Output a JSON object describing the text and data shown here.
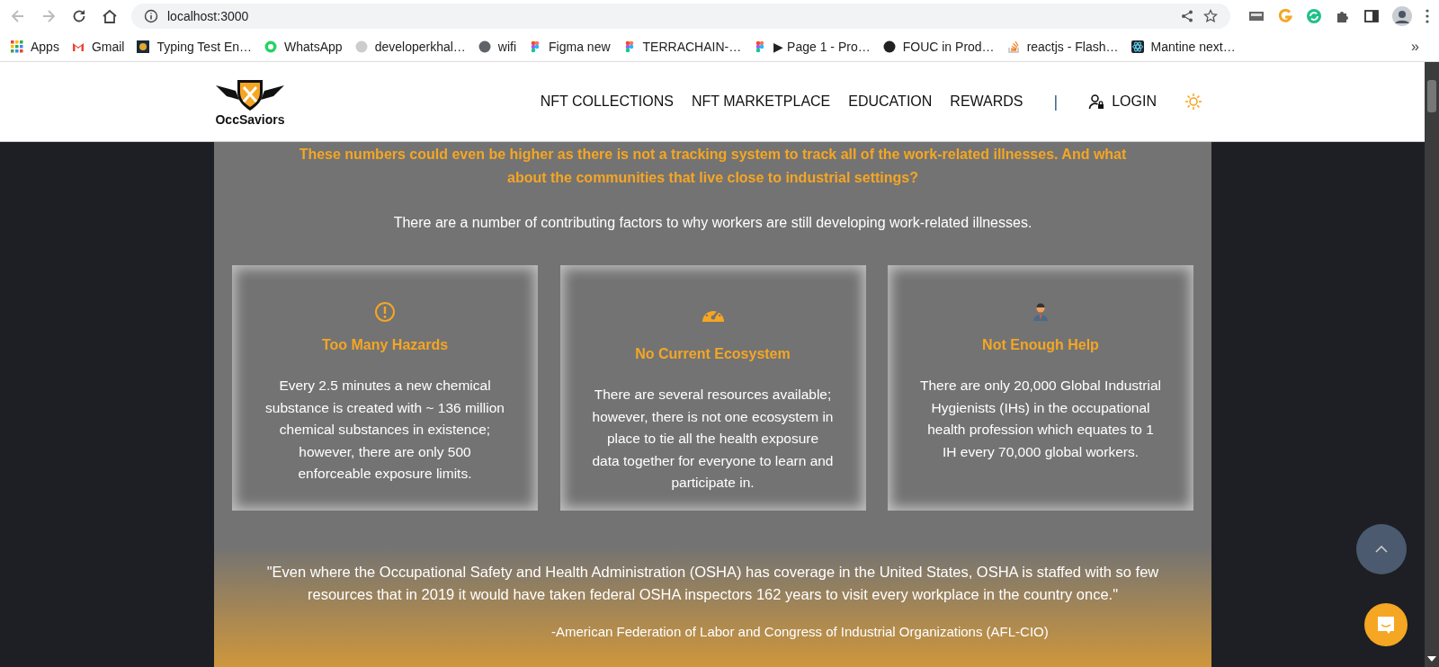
{
  "browser": {
    "address": "localhost:3000",
    "bookmarks": [
      {
        "label": "Apps",
        "kind": "apps"
      },
      {
        "label": "Gmail",
        "kind": "gmail"
      },
      {
        "label": "Typing Test En…",
        "kind": "dark"
      },
      {
        "label": "WhatsApp",
        "kind": "whatsapp"
      },
      {
        "label": "developerkhal…",
        "kind": "khal"
      },
      {
        "label": "wifi",
        "kind": "globe"
      },
      {
        "label": "Figma new",
        "kind": "figma"
      },
      {
        "label": "TERRACHAIN-…",
        "kind": "figma"
      },
      {
        "label": "▶ Page 1 - Pro…",
        "kind": "figma"
      },
      {
        "label": "FOUC in Prod…",
        "kind": "github"
      },
      {
        "label": "reactjs - Flash…",
        "kind": "stack"
      },
      {
        "label": "Mantine next…",
        "kind": "react"
      }
    ],
    "more": "»"
  },
  "header": {
    "logo_text": "OccSaviors",
    "nav": [
      "NFT COLLECTIONS",
      "NFT MARKETPLACE",
      "EDUCATION",
      "REWARDS"
    ],
    "separator": "|",
    "login": "LOGIN"
  },
  "intro": {
    "highlight": "These numbers could even be higher as there is not a tracking system to track all of the work-related illnesses. And what about the communities that live close to industrial settings?",
    "text": "There are a number of contributing factors to why workers are still developing work-related illnesses."
  },
  "cards": [
    {
      "kind": "alert",
      "title": "Too Many Hazards",
      "text": "Every 2.5 minutes a new chemical substance is created with ~ 136 million chemical substances in existence; however, there are only 500 enforceable exposure limits."
    },
    {
      "kind": "gauge",
      "title": "No Current Ecosystem",
      "text": "There are several resources available; however, there is not one ecosystem in place to tie all the health exposure data together for everyone to learn and participate in."
    },
    {
      "kind": "person",
      "title": "Not Enough Help",
      "text": "There are only 20,000 Global Industrial Hygienists (IHs) in the occupational health profession which equates to 1 IH every 70,000 global workers."
    }
  ],
  "quote": {
    "text": "\"Even where the Occupational Safety and Health Administration (OSHA) has coverage in the United States, OSHA is staffed with so few resources that in 2019 it would have taken federal OSHA inspectors 162 years to visit every workplace in the country once.\"",
    "source": "-American Federation of Labor and Congress of Industrial Organizations (AFL-CIO)"
  }
}
